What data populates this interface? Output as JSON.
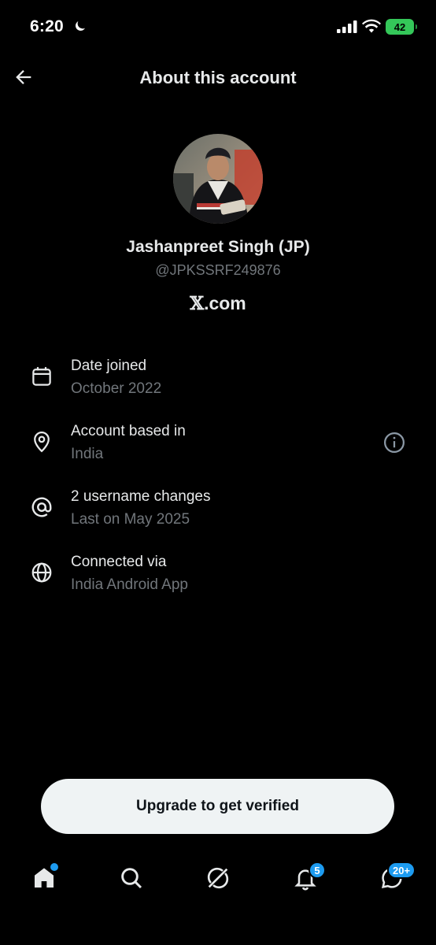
{
  "status_bar": {
    "time": "6:20",
    "battery": "42"
  },
  "header": {
    "title": "About this account"
  },
  "profile": {
    "name": "Jashanpreet Singh (JP)",
    "handle": "@JPKSSRF249876",
    "site_logo": "𝕏",
    "site_suffix": ".com"
  },
  "info": [
    {
      "icon": "calendar-icon",
      "title": "Date joined",
      "subtitle": "October 2022"
    },
    {
      "icon": "location-pin-icon",
      "title": "Account based in",
      "subtitle": "India"
    },
    {
      "icon": "at-sign-icon",
      "title": "2 username changes",
      "subtitle": "Last on May 2025"
    },
    {
      "icon": "globe-icon",
      "title": "Connected via",
      "subtitle": "India Android App"
    }
  ],
  "upgrade": {
    "label": "Upgrade to get verified"
  },
  "nav": {
    "notifications_badge": "5",
    "messages_badge": "20+"
  },
  "colors": {
    "background": "#000000",
    "accent": "#1d9bf0",
    "muted": "#71767b",
    "battery": "#34c759"
  }
}
